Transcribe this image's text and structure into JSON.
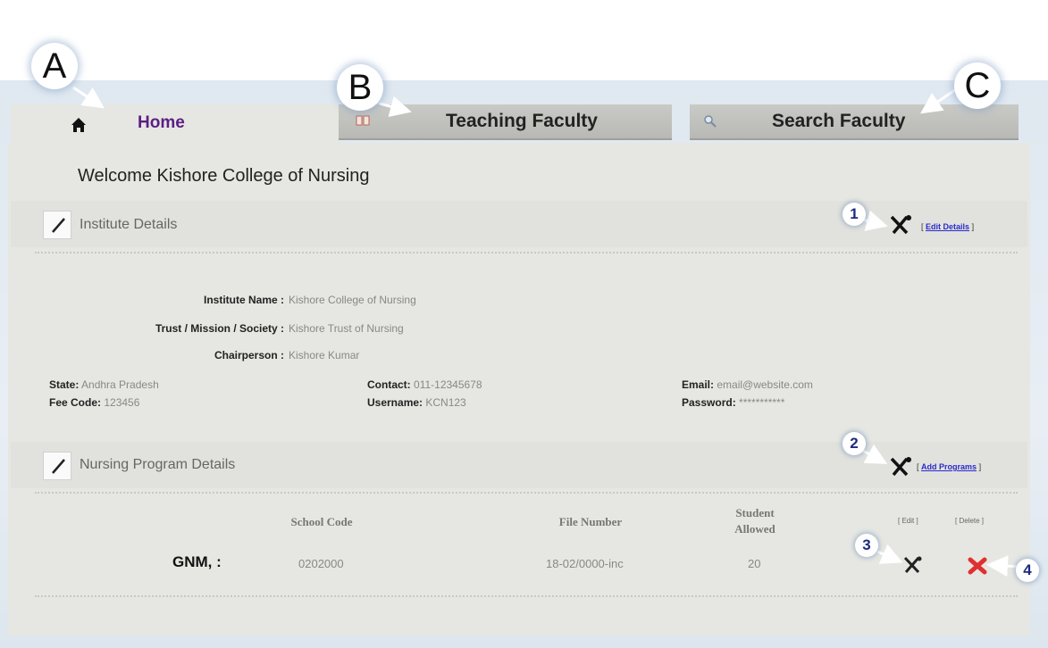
{
  "tabs": {
    "home": "Home",
    "teaching": "Teaching Faculty",
    "search": "Search Faculty"
  },
  "callouts": {
    "a": "A",
    "b": "B",
    "c": "C",
    "n1": "1",
    "n2": "2",
    "n3": "3",
    "n4": "4"
  },
  "welcome": "Welcome Kishore College of Nursing",
  "institute": {
    "title": "Institute Details",
    "edit_bracket_open": "[",
    "edit_link": "Edit Details",
    "edit_bracket_close": "]",
    "name_label": "Institute Name :",
    "name_value": "Kishore College of Nursing",
    "trust_label": "Trust / Mission / Society :",
    "trust_value": "Kishore Trust of Nursing",
    "chair_label": "Chairperson :",
    "chair_value": "Kishore Kumar",
    "state_label": "State:",
    "state_value": "Andhra Pradesh",
    "fee_label": "Fee Code:",
    "fee_value": "123456",
    "contact_label": "Contact:",
    "contact_value": "011-12345678",
    "username_label": "Username:",
    "username_value": "KCN123",
    "email_label": "Email:",
    "email_value": "email@website.com",
    "password_label": "Password:",
    "password_value": "***********"
  },
  "programs": {
    "title": "Nursing Program Details",
    "add_link": "Add Programs",
    "headers": {
      "school_code": "School Code",
      "file_number": "File Number",
      "student_allowed_1": "Student",
      "student_allowed_2": "Allowed",
      "edit": "[ Edit ]",
      "delete": "[ Delete ]"
    },
    "rows": [
      {
        "program": "GNM, :",
        "school_code": "0202000",
        "file_number": "18-02/0000-inc",
        "students": "20"
      }
    ]
  },
  "icons": {
    "home": "home-icon",
    "teaching": "book-icon",
    "search": "magnifier-icon",
    "edit": "tools-icon",
    "delete": "red-x-icon",
    "section": "pencil-icon"
  },
  "colors": {
    "home_tab_text": "#5a1f86",
    "link": "#2a2acb",
    "delete": "#e03030",
    "callout_number": "#1d2a80"
  }
}
